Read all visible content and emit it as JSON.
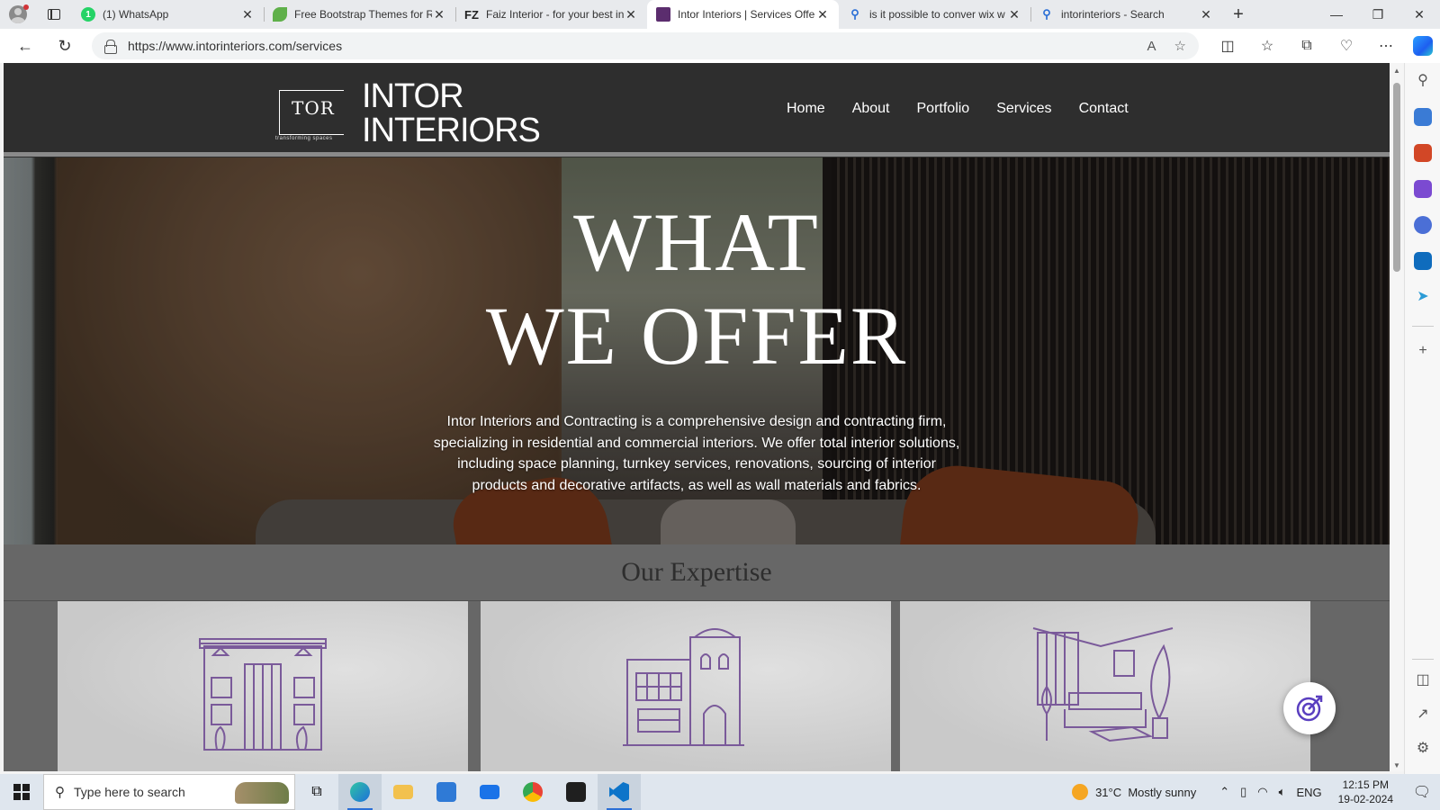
{
  "browser": {
    "tabs": [
      {
        "title": "(1) WhatsApp",
        "favicon": "whatsapp-icon",
        "color": "#25d366",
        "badge": "1",
        "active": false
      },
      {
        "title": "Free Bootstrap Themes for R",
        "favicon": "bootstrap-leaf-icon",
        "color": "#5fb04a",
        "active": false
      },
      {
        "title": "Faiz Interior - for your best in",
        "favicon": "fz-icon",
        "color": "#222222",
        "active": false
      },
      {
        "title": "Intor Interiors | Services Offe",
        "favicon": "intor-icon",
        "color": "#5b2d6e",
        "active": true
      },
      {
        "title": "is it possible to conver wix w",
        "favicon": "bing-search-icon",
        "color": "#2b6fd6",
        "active": false
      },
      {
        "title": "intorinteriors - Search",
        "favicon": "bing-search-icon",
        "color": "#2b6fd6",
        "active": false
      }
    ],
    "url": "https://www.intorinteriors.com/services"
  },
  "site": {
    "logo": {
      "mark": "TOR",
      "tagline": "transforming spaces",
      "line1": "INTOR",
      "line2": "INTERIORS"
    },
    "nav": [
      "Home",
      "About",
      "Portfolio",
      "Services",
      "Contact"
    ],
    "hero": {
      "line1": "WHAT",
      "line2": "WE OFFER",
      "description": "Intor Interiors and Contracting is a comprehensive design and contracting firm, specializing in residential and commercial interiors. We offer total interior solutions, including space planning, turnkey services, renovations, sourcing of interior products and decorative artifacts, as well as wall materials and fabrics."
    },
    "expertise": {
      "heading": "Our Expertise"
    }
  },
  "taskbar": {
    "search_placeholder": "Type here to search",
    "weather": {
      "temp": "31°C",
      "condition": "Mostly sunny"
    },
    "language": "ENG",
    "time": "12:15 PM",
    "date": "19-02-2024"
  },
  "colors": {
    "accent": "#2b6fd6",
    "site_header": "#2e2e2e",
    "expertise_bg": "#676767",
    "illustration": "#7a5a9a"
  }
}
